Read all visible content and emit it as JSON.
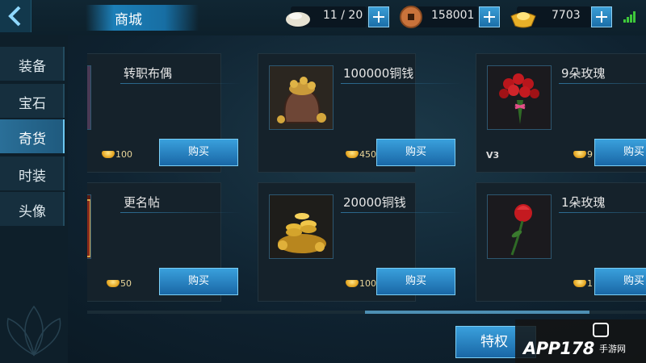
{
  "header": {
    "title": "商城",
    "stamina": "11 / 20",
    "copper": "158001",
    "gold": "7703"
  },
  "sidebar": {
    "tabs": [
      {
        "label": "装备",
        "active": false
      },
      {
        "label": "宝石",
        "active": false
      },
      {
        "label": "奇货",
        "active": true
      },
      {
        "label": "时装",
        "active": false
      },
      {
        "label": "头像",
        "active": false
      }
    ]
  },
  "shop": {
    "buy_label": "购买",
    "items": [
      {
        "name": "转职布偶",
        "price": "100",
        "icon": "doll-icon"
      },
      {
        "name": "100000铜钱",
        "price": "450",
        "icon": "coin-bag-icon"
      },
      {
        "name": "9朵玫瑰",
        "price": "9",
        "vip": "V3",
        "icon": "rose-bouquet-icon"
      },
      {
        "name": "更名帖",
        "price": "50",
        "icon": "rename-card-icon"
      },
      {
        "name": "20000铜钱",
        "price": "100",
        "icon": "coin-pile-icon"
      },
      {
        "name": "1朵玫瑰",
        "price": "1",
        "icon": "rose-icon"
      }
    ]
  },
  "footer": {
    "special_label": "特权"
  },
  "watermark": {
    "brand": "APP178",
    "sub": "手游网"
  },
  "colors": {
    "accent": "#1c7fb8",
    "button": "#2584c4",
    "price": "#e9d69a",
    "signal": "#3ec83a"
  }
}
